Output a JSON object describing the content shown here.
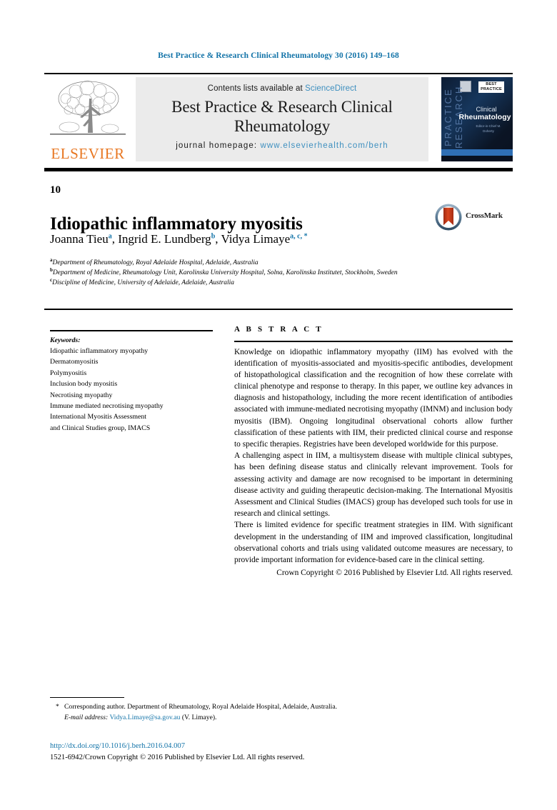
{
  "running_head": "Best Practice & Research Clinical Rheumatology 30 (2016) 149–168",
  "header": {
    "contents_prefix": "Contents lists available at",
    "sciencedirect_link": "ScienceDirect",
    "journal_title": "Best Practice & Research Clinical Rheumatology",
    "homepage_label": "journal homepage:",
    "homepage_url": "www.elsevierhealth.com/berh",
    "publisher_logo_text": "ELSEVIER",
    "cover": {
      "vertical_text": "PRACTICE RESEARCH",
      "badge_text": "BEST PRACTICE",
      "line1": "Clinical",
      "line2": "Rheumatology",
      "sub": "Editor-in-Chief\nM. Doherty"
    }
  },
  "article": {
    "chapter_number": "10",
    "title": "Idiopathic inflammatory myositis",
    "authors": [
      {
        "name": "Joanna Tieu",
        "marks": "a"
      },
      {
        "name": "Ingrid E. Lundberg",
        "marks": "b"
      },
      {
        "name": "Vidya Limaye",
        "marks": "a, c, *"
      }
    ],
    "affiliations": [
      {
        "mark": "a",
        "text": "Department of Rheumatology, Royal Adelaide Hospital, Adelaide, Australia"
      },
      {
        "mark": "b",
        "text": "Department of Medicine, Rheumatology Unit, Karolinska University Hospital, Solna, Karolinska Institutet, Stockholm, Sweden"
      },
      {
        "mark": "c",
        "text": "Discipline of Medicine, University of Adelaide, Adelaide, Australia"
      }
    ],
    "crossmark_label": "CrossMark"
  },
  "keywords": {
    "heading": "Keywords:",
    "items": [
      "Idiopathic inflammatory myopathy",
      "Dermatomyositis",
      "Polymyositis",
      "Inclusion body myositis",
      "Necrotising myopathy",
      "Immune mediated necrotising myopathy",
      "International Myositis Assessment",
      "and Clinical Studies group, IMACS"
    ]
  },
  "abstract": {
    "heading": "A B S T R A C T",
    "paragraphs": [
      "Knowledge on idiopathic inflammatory myopathy (IIM) has evolved with the identification of myositis-associated and myositis-specific antibodies, development of histopathological classification and the recognition of how these correlate with clinical phenotype and response to therapy. In this paper, we outline key advances in diagnosis and histopathology, including the more recent identification of antibodies associated with immune-mediated necrotising myopathy (IMNM) and inclusion body myositis (IBM). Ongoing longitudinal observational cohorts allow further classification of these patients with IIM, their predicted clinical course and response to specific therapies. Registries have been developed worldwide for this purpose.",
      "A challenging aspect in IIM, a multisystem disease with multiple clinical subtypes, has been defining disease status and clinically relevant improvement. Tools for assessing activity and damage are now recognised to be important in determining disease activity and guiding therapeutic decision-making. The International Myositis Assessment and Clinical Studies (IMACS) group has developed such tools for use in research and clinical settings.",
      "There is limited evidence for specific treatment strategies in IIM. With significant development in the understanding of IIM and improved classification, longitudinal observational cohorts and trials using validated outcome measures are necessary, to provide important information for evidence-based care in the clinical setting."
    ],
    "copyright": "Crown Copyright © 2016 Published by Elsevier Ltd. All rights reserved."
  },
  "footer": {
    "corresponding_marker": "*",
    "corresponding_text": "Corresponding author. Department of Rheumatology, Royal Adelaide Hospital, Adelaide, Australia.",
    "email_label": "E-mail address:",
    "email": "Vidya.Limaye@sa.gov.au",
    "email_suffix": "(V. Limaye).",
    "doi": "http://dx.doi.org/10.1016/j.berh.2016.04.007",
    "issn_line": "1521-6942/Crown Copyright © 2016 Published by Elsevier Ltd. All rights reserved."
  },
  "colors": {
    "link_blue": "#1273a8",
    "sd_blue": "#3d8fbf",
    "elsevier_orange": "#e87722",
    "panel_gray": "#ebebeb"
  }
}
